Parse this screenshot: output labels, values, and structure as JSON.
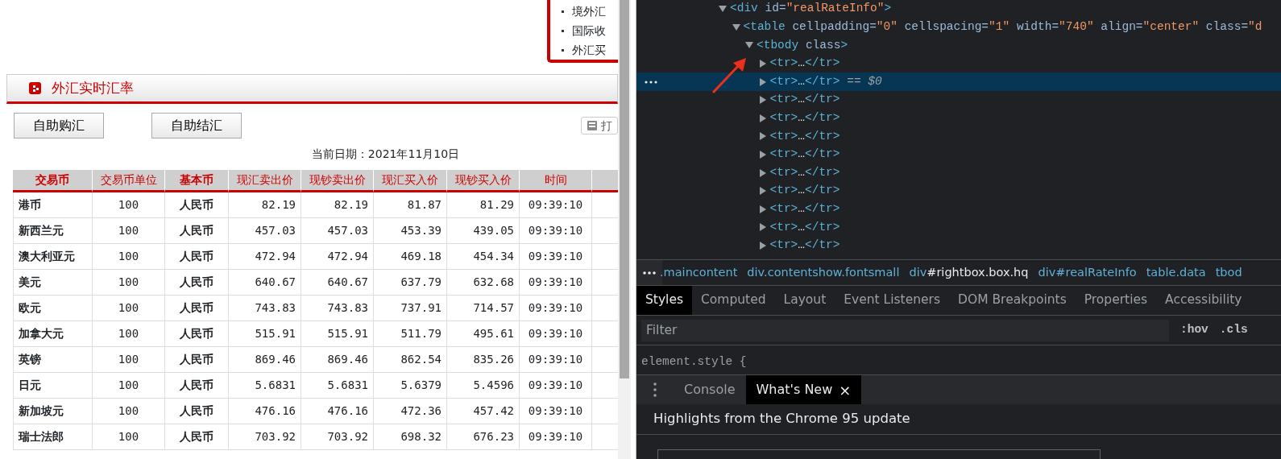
{
  "page": {
    "notice_links": [
      "境外汇",
      "国际收",
      "外汇买"
    ],
    "section_title": "外汇实时汇率",
    "buttons": [
      "自助购汇",
      "自助结汇"
    ],
    "print_button": "打",
    "date_line": "当前日期：2021年11月10日",
    "table": {
      "columns": [
        {
          "label": "交易币",
          "kind": "name"
        },
        {
          "label": "交易币单位",
          "kind": "unit"
        },
        {
          "label": "基本币",
          "kind": "base"
        },
        {
          "label": "现汇卖出价",
          "kind": "price"
        },
        {
          "label": "现钞卖出价",
          "kind": "price"
        },
        {
          "label": "现汇买入价",
          "kind": "price"
        },
        {
          "label": "现钞买入价",
          "kind": "price"
        },
        {
          "label": "时间",
          "kind": "time"
        }
      ],
      "rows": [
        {
          "cells": [
            "港币",
            "100",
            "人民币",
            "82.19",
            "82.19",
            "81.87",
            "81.29",
            "09:39:10"
          ]
        },
        {
          "cells": [
            "新西兰元",
            "100",
            "人民币",
            "457.03",
            "457.03",
            "453.39",
            "439.05",
            "09:39:10"
          ]
        },
        {
          "cells": [
            "澳大利亚元",
            "100",
            "人民币",
            "472.94",
            "472.94",
            "469.18",
            "454.34",
            "09:39:10"
          ]
        },
        {
          "cells": [
            "美元",
            "100",
            "人民币",
            "640.67",
            "640.67",
            "637.79",
            "632.68",
            "09:39:10"
          ]
        },
        {
          "cells": [
            "欧元",
            "100",
            "人民币",
            "743.83",
            "743.83",
            "737.91",
            "714.57",
            "09:39:10"
          ]
        },
        {
          "cells": [
            "加拿大元",
            "100",
            "人民币",
            "515.91",
            "515.91",
            "511.79",
            "495.61",
            "09:39:10"
          ]
        },
        {
          "cells": [
            "英镑",
            "100",
            "人民币",
            "869.46",
            "869.46",
            "862.54",
            "835.26",
            "09:39:10"
          ]
        },
        {
          "cells": [
            "日元",
            "100",
            "人民币",
            "5.6831",
            "5.6831",
            "5.6379",
            "5.4596",
            "09:39:10"
          ]
        },
        {
          "cells": [
            "新加坡元",
            "100",
            "人民币",
            "476.16",
            "476.16",
            "472.36",
            "457.42",
            "09:39:10"
          ]
        },
        {
          "cells": [
            "瑞士法郎",
            "100",
            "人民币",
            "703.92",
            "703.92",
            "698.32",
            "676.23",
            "09:39:10"
          ]
        }
      ]
    }
  },
  "devtools": {
    "dom_tree": [
      {
        "expanded": true,
        "selected": false,
        "parts": [
          {
            "kind": "tag",
            "text": "<div"
          },
          {
            "kind": "attr",
            "text": " id="
          },
          {
            "kind": "value",
            "text": "\"realRateInfo\""
          },
          {
            "kind": "tag",
            "text": ">"
          }
        ],
        "children": [
          {
            "expanded": true,
            "selected": false,
            "parts": [
              {
                "kind": "tag",
                "text": "<table"
              },
              {
                "kind": "attr",
                "text": " cellpadding="
              },
              {
                "kind": "value",
                "text": "\"0\""
              },
              {
                "kind": "attr",
                "text": " cellspacing="
              },
              {
                "kind": "value",
                "text": "\"1\""
              },
              {
                "kind": "attr",
                "text": " width="
              },
              {
                "kind": "value",
                "text": "\"740\""
              },
              {
                "kind": "attr",
                "text": " align="
              },
              {
                "kind": "value",
                "text": "\"center\""
              },
              {
                "kind": "attr",
                "text": " class="
              },
              {
                "kind": "value",
                "text": "\"d"
              }
            ],
            "children": [
              {
                "expanded": true,
                "selected": false,
                "parts": [
                  {
                    "kind": "tag",
                    "text": "<tbody"
                  },
                  {
                    "kind": "attr",
                    "text": " class"
                  },
                  {
                    "kind": "tag",
                    "text": ">"
                  }
                ],
                "children": [
                  {
                    "expanded": false,
                    "selected": false,
                    "parts": [
                      {
                        "kind": "tag",
                        "text": "<tr>"
                      },
                      {
                        "kind": "text",
                        "text": "…"
                      },
                      {
                        "kind": "tag",
                        "text": "</tr>"
                      }
                    ]
                  },
                  {
                    "expanded": false,
                    "selected": true,
                    "parts": [
                      {
                        "kind": "tag",
                        "text": "<tr>"
                      },
                      {
                        "kind": "text",
                        "text": "…"
                      },
                      {
                        "kind": "tag",
                        "text": "</tr>"
                      },
                      {
                        "kind": "ref",
                        "text": " == $0"
                      }
                    ]
                  },
                  {
                    "expanded": false,
                    "selected": false,
                    "parts": [
                      {
                        "kind": "tag",
                        "text": "<tr>"
                      },
                      {
                        "kind": "text",
                        "text": "…"
                      },
                      {
                        "kind": "tag",
                        "text": "</tr>"
                      }
                    ]
                  },
                  {
                    "expanded": false,
                    "selected": false,
                    "parts": [
                      {
                        "kind": "tag",
                        "text": "<tr>"
                      },
                      {
                        "kind": "text",
                        "text": "…"
                      },
                      {
                        "kind": "tag",
                        "text": "</tr>"
                      }
                    ]
                  },
                  {
                    "expanded": false,
                    "selected": false,
                    "parts": [
                      {
                        "kind": "tag",
                        "text": "<tr>"
                      },
                      {
                        "kind": "text",
                        "text": "…"
                      },
                      {
                        "kind": "tag",
                        "text": "</tr>"
                      }
                    ]
                  },
                  {
                    "expanded": false,
                    "selected": false,
                    "parts": [
                      {
                        "kind": "tag",
                        "text": "<tr>"
                      },
                      {
                        "kind": "text",
                        "text": "…"
                      },
                      {
                        "kind": "tag",
                        "text": "</tr>"
                      }
                    ]
                  },
                  {
                    "expanded": false,
                    "selected": false,
                    "parts": [
                      {
                        "kind": "tag",
                        "text": "<tr>"
                      },
                      {
                        "kind": "text",
                        "text": "…"
                      },
                      {
                        "kind": "tag",
                        "text": "</tr>"
                      }
                    ]
                  },
                  {
                    "expanded": false,
                    "selected": false,
                    "parts": [
                      {
                        "kind": "tag",
                        "text": "<tr>"
                      },
                      {
                        "kind": "text",
                        "text": "…"
                      },
                      {
                        "kind": "tag",
                        "text": "</tr>"
                      }
                    ]
                  },
                  {
                    "expanded": false,
                    "selected": false,
                    "parts": [
                      {
                        "kind": "tag",
                        "text": "<tr>"
                      },
                      {
                        "kind": "text",
                        "text": "…"
                      },
                      {
                        "kind": "tag",
                        "text": "</tr>"
                      }
                    ]
                  },
                  {
                    "expanded": false,
                    "selected": false,
                    "parts": [
                      {
                        "kind": "tag",
                        "text": "<tr>"
                      },
                      {
                        "kind": "text",
                        "text": "…"
                      },
                      {
                        "kind": "tag",
                        "text": "</tr>"
                      }
                    ]
                  },
                  {
                    "expanded": false,
                    "selected": false,
                    "parts": [
                      {
                        "kind": "tag",
                        "text": "<tr>"
                      },
                      {
                        "kind": "text",
                        "text": "…"
                      },
                      {
                        "kind": "tag",
                        "text": "</tr>"
                      }
                    ]
                  }
                ]
              }
            ]
          }
        ]
      }
    ],
    "breadcrumbs": [
      {
        "parts": [
          ".maincontent"
        ],
        "hovered": false
      },
      {
        "parts": [
          "div",
          ".contentshow.fontsmall"
        ],
        "hovered": false
      },
      {
        "parts": [
          "div",
          "#rightbox.box.hq"
        ],
        "hovered": true
      },
      {
        "parts": [
          "div",
          "#realRateInfo"
        ],
        "hovered": false
      },
      {
        "parts": [
          "table",
          ".data"
        ],
        "hovered": false
      },
      {
        "parts": [
          "tbod"
        ],
        "hovered": false
      }
    ],
    "panel_tabs": [
      {
        "label": "Styles",
        "selected": true
      },
      {
        "label": "Computed",
        "selected": false
      },
      {
        "label": "Layout",
        "selected": false
      },
      {
        "label": "Event Listeners",
        "selected": false
      },
      {
        "label": "DOM Breakpoints",
        "selected": false
      },
      {
        "label": "Properties",
        "selected": false
      },
      {
        "label": "Accessibility",
        "selected": false
      }
    ],
    "filter": {
      "placeholder": "Filter"
    },
    "filter_toggles": [
      ":hov",
      ".cls"
    ],
    "style_rule": "element.style {",
    "drawer_tabs": [
      {
        "label": "Console",
        "selected": false,
        "closable": false
      },
      {
        "label": "What's New",
        "selected": true,
        "closable": true
      }
    ],
    "close_glyph": "×",
    "drawer_heading": "Highlights from the Chrome 95 update"
  }
}
